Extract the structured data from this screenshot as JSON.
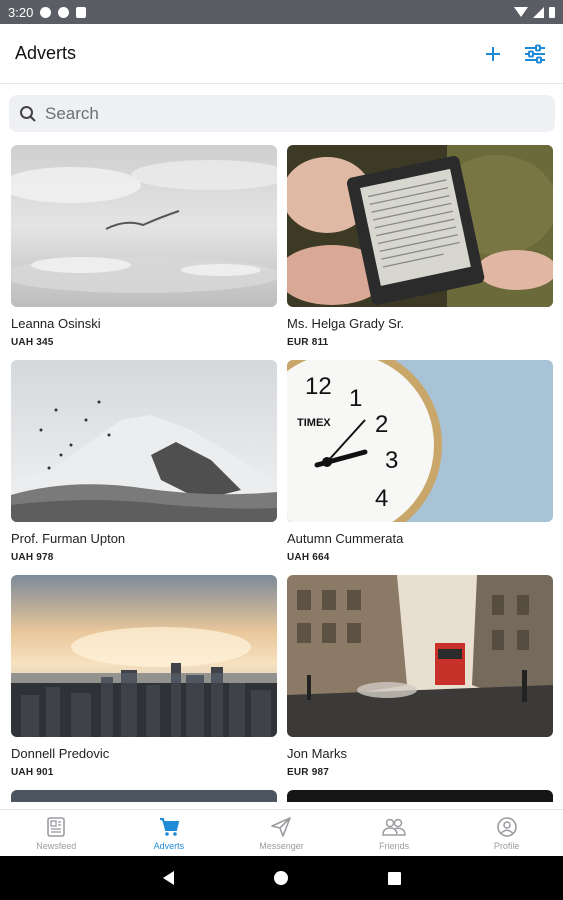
{
  "status_bar": {
    "time": "3:20"
  },
  "header": {
    "title": "Adverts",
    "add_icon": "plus-icon",
    "filter_icon": "sliders-icon"
  },
  "search": {
    "placeholder": "Search",
    "value": ""
  },
  "adverts": [
    {
      "name": "Leanna Osinski",
      "price": "UAH 345",
      "image": "misty-sky-with-bird"
    },
    {
      "name": "Ms. Helga Grady Sr.",
      "price": "EUR 811",
      "image": "hand-holding-ereader"
    },
    {
      "name": "Prof. Furman Upton",
      "price": "UAH 978",
      "image": "snowy-mountain-with-birds"
    },
    {
      "name": "Autumn Cummerata",
      "price": "UAH 664",
      "image": "timex-clock-face"
    },
    {
      "name": "Donnell Predovic",
      "price": "UAH 901",
      "image": "city-skyline-sunset"
    },
    {
      "name": "Jon Marks",
      "price": "EUR 987",
      "image": "busy-city-street"
    }
  ],
  "bottom_nav": [
    {
      "label": "Newsfeed",
      "icon": "newspaper-icon",
      "active": false
    },
    {
      "label": "Adverts",
      "icon": "cart-icon",
      "active": true
    },
    {
      "label": "Messenger",
      "icon": "paper-plane-icon",
      "active": false
    },
    {
      "label": "Friends",
      "icon": "people-icon",
      "active": false
    },
    {
      "label": "Profile",
      "icon": "profile-icon",
      "active": false
    }
  ],
  "colors": {
    "accent": "#1f8bd6",
    "status_bar": "#5a5d63",
    "search_bg": "#eef0f3"
  }
}
